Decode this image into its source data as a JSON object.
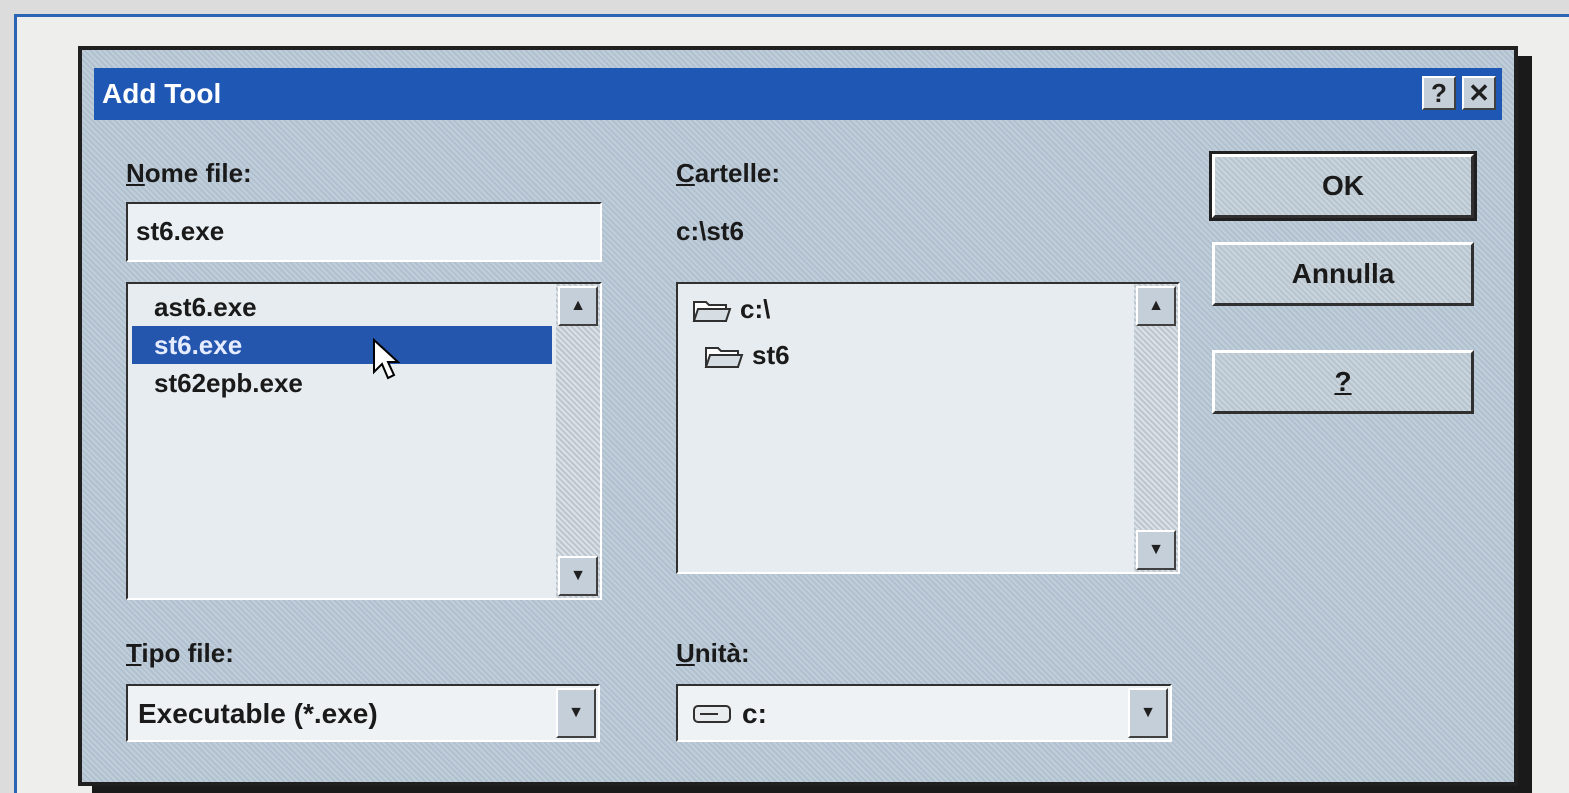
{
  "dialog": {
    "title": "Add Tool",
    "help_btn": "?",
    "close_btn": "✕"
  },
  "file_name": {
    "label_underlined": "N",
    "label_rest": "ome file:",
    "value": "st6.exe",
    "files": [
      "ast6.exe",
      "st6.exe",
      "st62epb.exe"
    ],
    "selected_index": 1
  },
  "folders": {
    "label_underlined": "C",
    "label_rest": "artelle:",
    "current_path": "c:\\st6",
    "items": [
      {
        "name": "c:\\",
        "icon": "open-folder-icon"
      },
      {
        "name": "st6",
        "icon": "open-folder-icon"
      }
    ]
  },
  "file_type": {
    "label_underlined": "T",
    "label_rest": "ipo file:",
    "value": "Executable (*.exe)"
  },
  "drive": {
    "label_underlined": "U",
    "label_rest": "nità:",
    "value": "c:",
    "icon": "drive-icon"
  },
  "buttons": {
    "ok": "OK",
    "cancel": "Annulla",
    "help": "?"
  }
}
